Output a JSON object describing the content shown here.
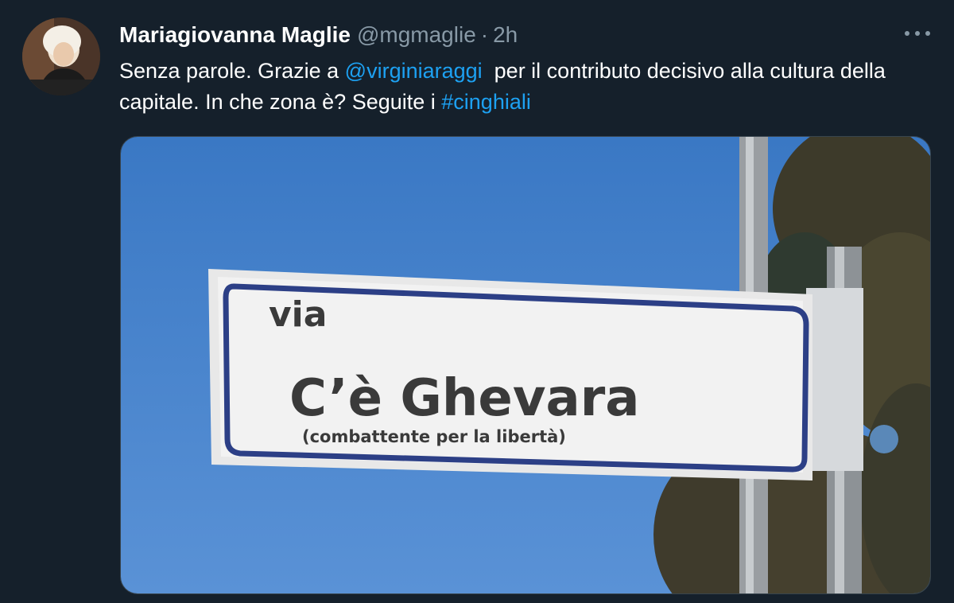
{
  "tweet": {
    "author_name": "Mariagiovanna Maglie",
    "handle": "@mgmaglie",
    "separator": "·",
    "time": "2h",
    "text": {
      "part1": "Senza parole. Grazie a ",
      "mention": "@virginiaraggi",
      "part2": "  per il contributo decisivo alla cultura della capitale. In che zona è? Seguite i ",
      "hashtag": "#cinghiali"
    },
    "more_icon": "more-horizontal-icon"
  },
  "media": {
    "sign": {
      "prefix": "via",
      "name": "C’è Ghevara",
      "subtitle": "(combattente per la libertà)"
    },
    "colors": {
      "sky": "#3f7fc8",
      "sign_bg": "#f2f2f2",
      "sign_border": "#2c3f86",
      "text": "#3a3a3a"
    }
  },
  "theme": {
    "background": "#15202b",
    "link": "#1da1f2",
    "secondary_text": "#8899a6"
  }
}
